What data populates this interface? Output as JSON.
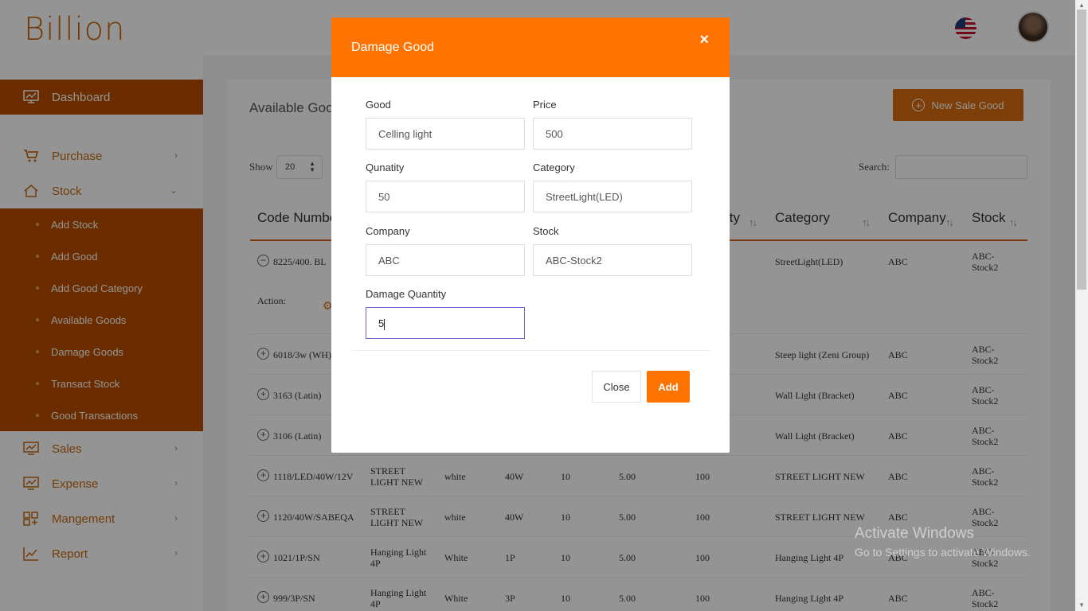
{
  "app": {
    "logo": "Billion"
  },
  "sidebar": {
    "dashboard": "Dashboard",
    "purchase": "Purchase",
    "stock": "Stock",
    "stock_items": [
      "Add Stock",
      "Add Good",
      "Add Good Category",
      "Available Goods",
      "Damage Goods",
      "Transact Stock",
      "Good Transactions"
    ],
    "sales": "Sales",
    "expense": "Expense",
    "management": "Mangement",
    "report": "Report"
  },
  "page": {
    "title": "Available Goods",
    "new_button": "New Sale Good",
    "show_label": "Show",
    "show_value": "20",
    "search_label": "Search:",
    "headers": {
      "code": "Code Number",
      "quantity": "ity",
      "category": "Category",
      "company": "Company",
      "stock": "Stock"
    },
    "action_label": "Action:",
    "rows": [
      {
        "code": "8225/400. BL",
        "name": "",
        "color": "",
        "watt": "",
        "qty": "",
        "price": "",
        "total": "",
        "category": "StreetLight(LED)",
        "company": "ABC",
        "stock": "ABC-Stock2"
      },
      {
        "code": "6018/3w (WH)",
        "name": "",
        "color": "",
        "watt": "",
        "qty": "",
        "price": "",
        "total": "",
        "category": "Steep light (Zeni Group)",
        "company": "ABC",
        "stock": "ABC-Stock2"
      },
      {
        "code": "3163 (Latin)",
        "name": "",
        "color": "",
        "watt": "",
        "qty": "",
        "price": "",
        "total": "",
        "category": "Wall Light (Bracket)",
        "company": "ABC",
        "stock": "ABC-Stock2"
      },
      {
        "code": "3106 (Latin)",
        "name": "",
        "color": "",
        "watt": "",
        "qty": "",
        "price": "",
        "total": "",
        "category": "Wall Light (Bracket)",
        "company": "ABC",
        "stock": "ABC-Stock2"
      },
      {
        "code": "1118/LED/40W/12V",
        "name": "STREET LIGHT NEW",
        "color": "white",
        "watt": "40W",
        "qty": "10",
        "price": "5.00",
        "total": "100",
        "category": "STREET LIGHT NEW",
        "company": "ABC",
        "stock": "ABC-Stock2"
      },
      {
        "code": "1120/40W/SABEQA",
        "name": "STREET LIGHT NEW",
        "color": "white",
        "watt": "40W",
        "qty": "10",
        "price": "5.00",
        "total": "100",
        "category": "STREET LIGHT NEW",
        "company": "ABC",
        "stock": "ABC-Stock2"
      },
      {
        "code": "1021/1P/SN",
        "name": "Hanging Light 4P",
        "color": "White",
        "watt": "1P",
        "qty": "10",
        "price": "5.00",
        "total": "100",
        "category": "Hanging Light 4P",
        "company": "ABC",
        "stock": "ABC-Stock2"
      },
      {
        "code": "999/3P/SN",
        "name": "Hanging Light 4P",
        "color": "White",
        "watt": "3P",
        "qty": "10",
        "price": "5.00",
        "total": "100",
        "category": "Hanging Light 4P",
        "company": "ABC",
        "stock": "ABC-Stock2"
      }
    ]
  },
  "modal": {
    "title": "Damage Good",
    "close_icon": "×",
    "good_label": "Good",
    "good_value": "Celling light",
    "price_label": "Price",
    "price_value": "500",
    "quantity_label": "Qunatity",
    "quantity_value": "50",
    "category_label": "Category",
    "category_value": "StreetLight(LED)",
    "company_label": "Company",
    "company_value": "ABC",
    "stock_label": "Stock",
    "stock_value": "ABC-Stock2",
    "damage_label": "Damage Quantity",
    "damage_value": "5",
    "close_button": "Close",
    "add_button": "Add"
  },
  "watermark": {
    "line1": "Activate Windows",
    "line2": "Go to Settings to activate Windows."
  },
  "colors": {
    "accent": "#ff7302",
    "sidebar_active": "#b94f00"
  }
}
